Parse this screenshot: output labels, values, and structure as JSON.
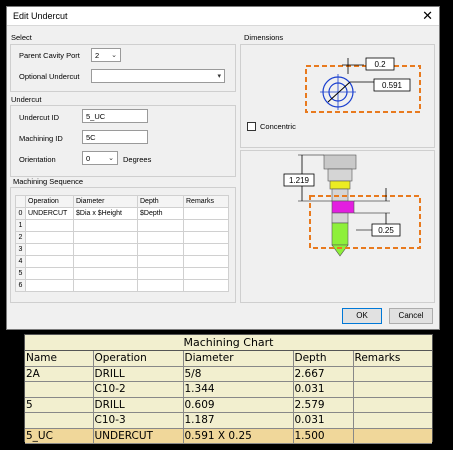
{
  "dialog": {
    "title": "Edit Undercut",
    "close_glyph": "✕",
    "ok_label": "OK",
    "cancel_label": "Cancel"
  },
  "select_group": {
    "label": "Select",
    "parent_cavity_port_label": "Parent Cavity Port",
    "parent_cavity_port_value": "2",
    "optional_undercut_label": "Optional Undercut",
    "optional_undercut_value": ""
  },
  "undercut_group": {
    "label": "Undercut",
    "undercut_id_label": "Undercut ID",
    "undercut_id_value": "5_UC",
    "machining_id_label": "Machining ID",
    "machining_id_value": "5C",
    "orientation_label": "Orientation",
    "orientation_value": "0",
    "orientation_unit": "Degrees"
  },
  "machining_sequence": {
    "label": "Machining Sequence",
    "columns": [
      "Operation",
      "Diameter",
      "Depth",
      "Remarks"
    ],
    "rows": [
      {
        "n": "0",
        "operation": "UNDERCUT",
        "diameter": "$Dia x $Height",
        "depth": "$Depth",
        "remarks": ""
      },
      {
        "n": "1",
        "operation": "",
        "diameter": "",
        "depth": "",
        "remarks": ""
      },
      {
        "n": "2",
        "operation": "",
        "diameter": "",
        "depth": "",
        "remarks": ""
      },
      {
        "n": "3",
        "operation": "",
        "diameter": "",
        "depth": "",
        "remarks": ""
      },
      {
        "n": "4",
        "operation": "",
        "diameter": "",
        "depth": "",
        "remarks": ""
      },
      {
        "n": "5",
        "operation": "",
        "diameter": "",
        "depth": "",
        "remarks": ""
      },
      {
        "n": "6",
        "operation": "",
        "diameter": "",
        "depth": "",
        "remarks": ""
      }
    ]
  },
  "dimensions": {
    "label": "Dimensions",
    "dim_a": "0.2",
    "dim_b": "0.591",
    "concentric_label": "Concentric",
    "concentric_checked": false,
    "dim_height": "1.219",
    "dim_undercut_height": "0.25",
    "accent_color": "#e87a1e"
  },
  "chart": {
    "title": "Machining Chart",
    "columns": [
      "Name",
      "Operation",
      "Diameter",
      "Depth",
      "Remarks"
    ],
    "rows": [
      {
        "name": "2A",
        "operation": "DRILL",
        "diameter": "5/8",
        "depth": "2.667",
        "remarks": ""
      },
      {
        "name": "",
        "operation": "C10-2",
        "diameter": "1.344",
        "depth": "0.031",
        "remarks": ""
      },
      {
        "name": "5",
        "operation": "DRILL",
        "diameter": "0.609",
        "depth": "2.579",
        "remarks": ""
      },
      {
        "name": "",
        "operation": "C10-3",
        "diameter": "1.187",
        "depth": "0.031",
        "remarks": ""
      },
      {
        "name": "5_UC",
        "operation": "UNDERCUT",
        "diameter": "0.591 X 0.25",
        "depth": "1.500",
        "remarks": ""
      }
    ],
    "highlight_color": "#f0d79a"
  }
}
